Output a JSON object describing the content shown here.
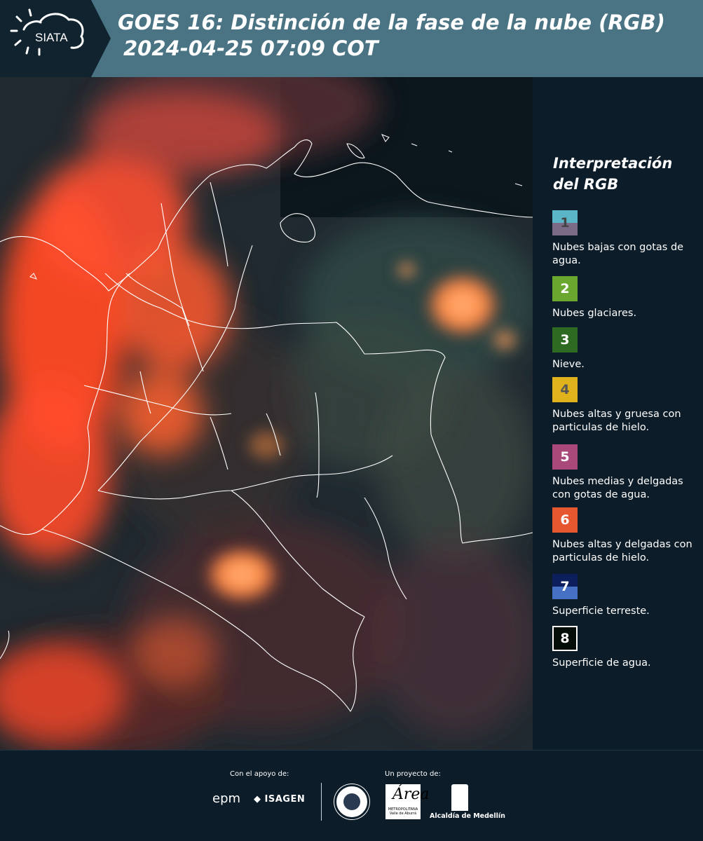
{
  "header": {
    "logo_text": "SIATA",
    "title_line1": "GOES 16: Distinción de la fase de la nube (RGB)",
    "title_line2": "2024-04-25 07:09 COT"
  },
  "legend": {
    "title": "Interpretación del RGB",
    "items": [
      {
        "number": "1",
        "label": "Nubes bajas con gotas de agua.",
        "color_top": "#5ab5c6",
        "color_bottom": "#7c6b86"
      },
      {
        "number": "2",
        "label": "Nubes glaciares.",
        "color": "#6aa72f"
      },
      {
        "number": "3",
        "label": "Nieve.",
        "color": "#2e6a22"
      },
      {
        "number": "4",
        "label": "Nubes altas y gruesa con particulas de hielo.",
        "color": "#e0b21c"
      },
      {
        "number": "5",
        "label": "Nubes medias y delgadas con gotas de agua.",
        "color": "#a9497a"
      },
      {
        "number": "6",
        "label": "Nubes altas y delgadas con particulas de hielo.",
        "color": "#e65730"
      },
      {
        "number": "7",
        "label": "Superficie terreste.",
        "color_top": "#0c1f5c",
        "color_bottom": "#4670c4"
      },
      {
        "number": "8",
        "label": "Superficie de agua.",
        "color": "#050d08"
      }
    ]
  },
  "footer": {
    "support_label": "Con el apoyo de:",
    "project_label": "Un proyecto de:",
    "sponsor_1": "epm",
    "sponsor_2": "ISAGEN",
    "partner_metro": "Área",
    "partner_metro_sub": "METROPOLITANA Valle de Aburrá",
    "partner_alcaldia": "Alcaldía de Medellín"
  }
}
